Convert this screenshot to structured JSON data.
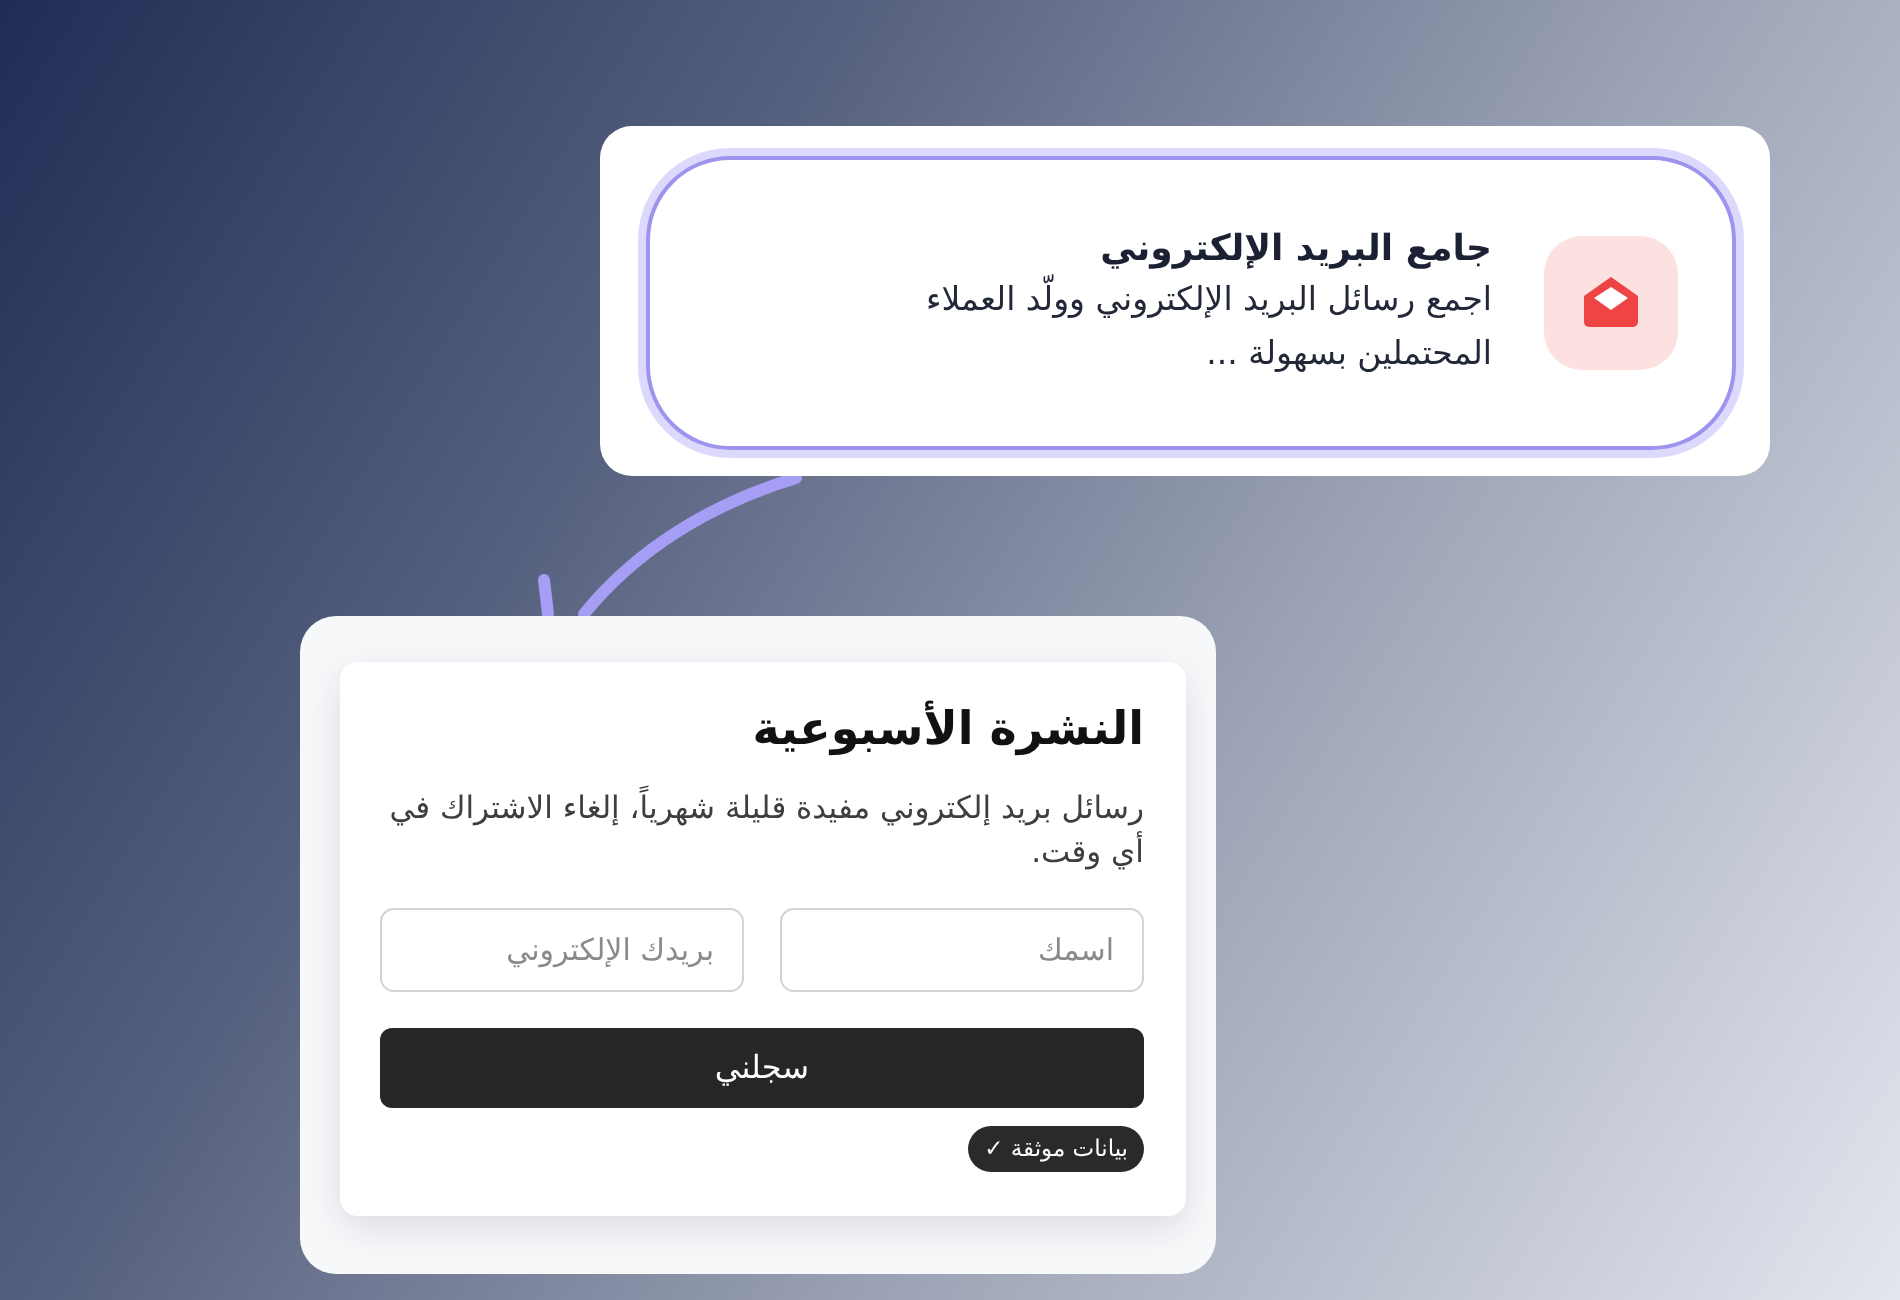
{
  "feature_card": {
    "title": "جامع البريد الإلكتروني",
    "description": "اجمع رسائل البريد الإلكتروني وولّد العملاء المحتملين بسهولة ..."
  },
  "newsletter": {
    "title": "النشرة الأسبوعية",
    "description": "رسائل بريد إلكتروني مفيدة قليلة شهرياً، إلغاء الاشتراك في أي وقت.",
    "fields": [
      {
        "placeholder": "اسمك"
      },
      {
        "placeholder": "بريدك الإلكتروني"
      }
    ],
    "button": "سجلني",
    "badge": "بيانات موثقة ✓"
  }
}
